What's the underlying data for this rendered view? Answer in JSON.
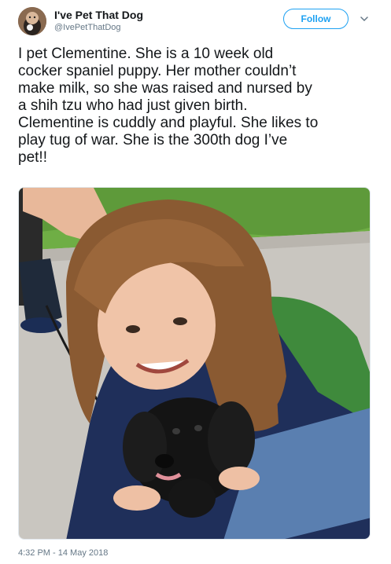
{
  "author": {
    "display_name": "I've Pet That Dog",
    "handle": "@IvePetThatDog",
    "avatar_icon": "dog-avatar-icon"
  },
  "actions": {
    "follow_label": "Follow",
    "menu_icon": "chevron-down-icon"
  },
  "tweet": {
    "lines": [
      "I pet Clementine. She is a 10 week old",
      "cocker spaniel puppy. Her mother couldn’t",
      "make milk, so she was raised and nursed by",
      "a shih tzu who had just given birth.",
      "Clementine is cuddly and playful. She likes to",
      "play tug of war. She is the 300th dog I’ve",
      "pet!!"
    ],
    "timestamp": "4:32 PM - 14 May 2018"
  },
  "colors": {
    "accent": "#1da1f2",
    "text": "#14171a",
    "muted": "#657786"
  }
}
